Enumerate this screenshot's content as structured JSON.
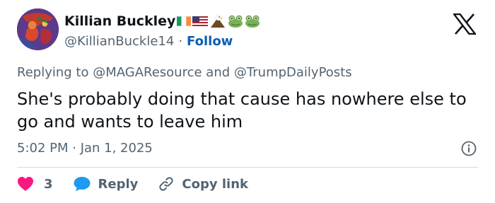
{
  "user": {
    "display_name": "Killian Buckley",
    "handle": "@KillianBuckle14",
    "separator": "·",
    "follow_label": "Follow",
    "badges": [
      "ireland-flag-icon",
      "usa-flag-icon",
      "eagle-icon",
      "frog-icon",
      "frog-icon"
    ]
  },
  "tweet": {
    "replying_prefix": "Replying to",
    "mention_1": "@MAGAResource",
    "and_word": "and",
    "mention_2": "@TrumpDailyPosts",
    "text": "She's probably doing that cause has nowhere else to go and wants to leave him",
    "timestamp": "5:02 PM · Jan 1, 2025"
  },
  "actions": {
    "like_count": "3",
    "reply_label": "Reply",
    "copy_label": "Copy link"
  },
  "colors": {
    "link": "#0a5fb4",
    "muted": "#536471",
    "text": "#0f1419",
    "like": "#f91880",
    "reply": "#1d9bf0"
  }
}
